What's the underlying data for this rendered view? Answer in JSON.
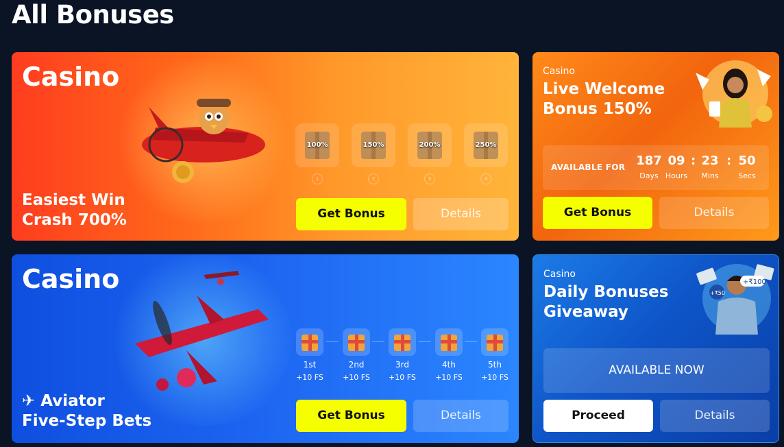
{
  "page": {
    "title": "All Bonuses"
  },
  "cards": [
    {
      "category": "Casino",
      "name_line1": "Easiest Win",
      "name_line2": "Crash 700%",
      "gifts": [
        "100%",
        "150%",
        "200%",
        "250%"
      ],
      "gift_numbers": [
        "1",
        "2",
        "3",
        "4"
      ],
      "primary_button": "Get Bonus",
      "secondary_button": "Details"
    },
    {
      "category": "Casino",
      "name_line1": "Aviator",
      "name_line2": "Five-Step Bets",
      "steps": [
        {
          "label": "1st",
          "reward": "+10 FS"
        },
        {
          "label": "2nd",
          "reward": "+10 FS"
        },
        {
          "label": "3rd",
          "reward": "+10 FS"
        },
        {
          "label": "4th",
          "reward": "+10 FS"
        },
        {
          "label": "5th",
          "reward": "+10 FS"
        }
      ],
      "primary_button": "Get Bonus",
      "secondary_button": "Details"
    },
    {
      "category": "Casino",
      "title_line1": "Live Welcome",
      "title_line2": "Bonus 150%",
      "available_label": "AVAILABLE FOR",
      "timer": {
        "days": "187",
        "hours": "09",
        "mins": "23",
        "secs": "50",
        "days_label": "Days",
        "hours_label": "Hours",
        "mins_label": "Mins",
        "secs_label": "Secs"
      },
      "primary_button": "Get Bonus",
      "secondary_button": "Details"
    },
    {
      "category": "Casino",
      "title_line1": "Daily Bonuses",
      "title_line2": "Giveaway",
      "status": "AVAILABLE NOW",
      "primary_button": "Proceed",
      "secondary_button": "Details",
      "art_badges": [
        "+₹100",
        "+₹50"
      ]
    }
  ],
  "colors": {
    "background": "#0b1424",
    "accent_yellow": "#f5ff00",
    "orange": "#ff6a1a",
    "blue": "#1c63f0"
  }
}
